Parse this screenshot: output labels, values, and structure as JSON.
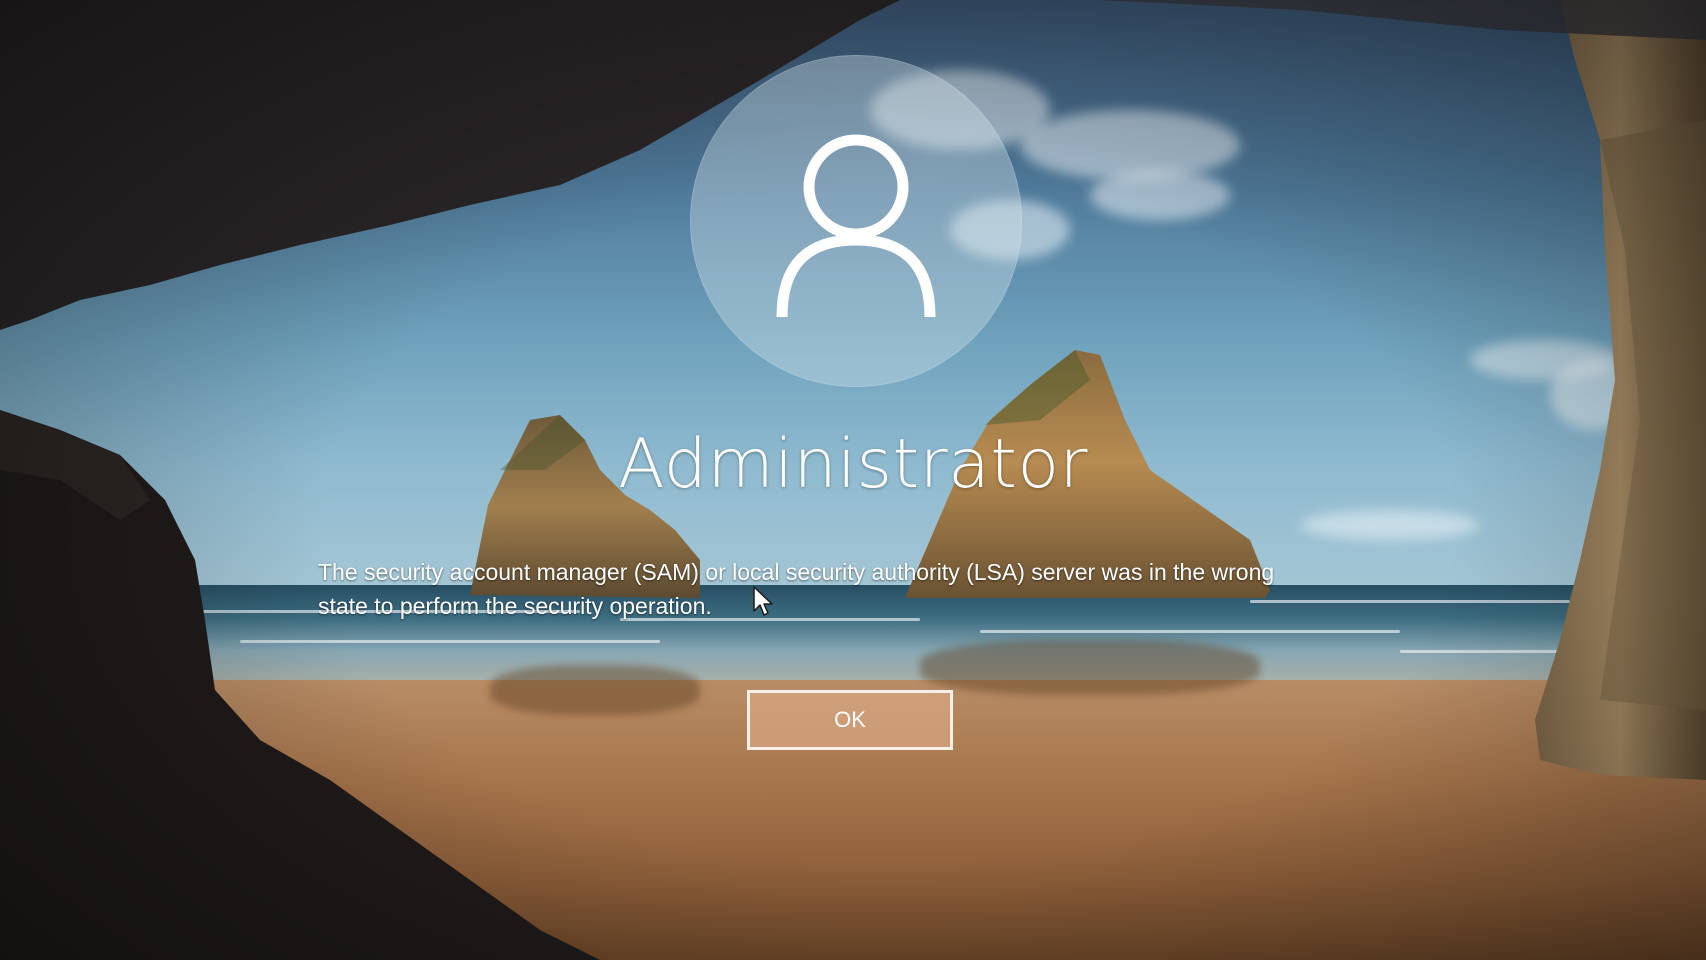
{
  "logon": {
    "username": "Administrator",
    "message_line1": "The security account manager (SAM) or local security authority (LSA) server was in the wrong",
    "message_line2": "state to perform the security operation.",
    "ok_label": "OK"
  },
  "icons": {
    "avatar": "user-silhouette-icon",
    "cursor": "mouse-pointer-icon"
  },
  "colors": {
    "text": "#ffffff",
    "button_border": "#f4efe9",
    "button_fill": "#d7a582"
  }
}
